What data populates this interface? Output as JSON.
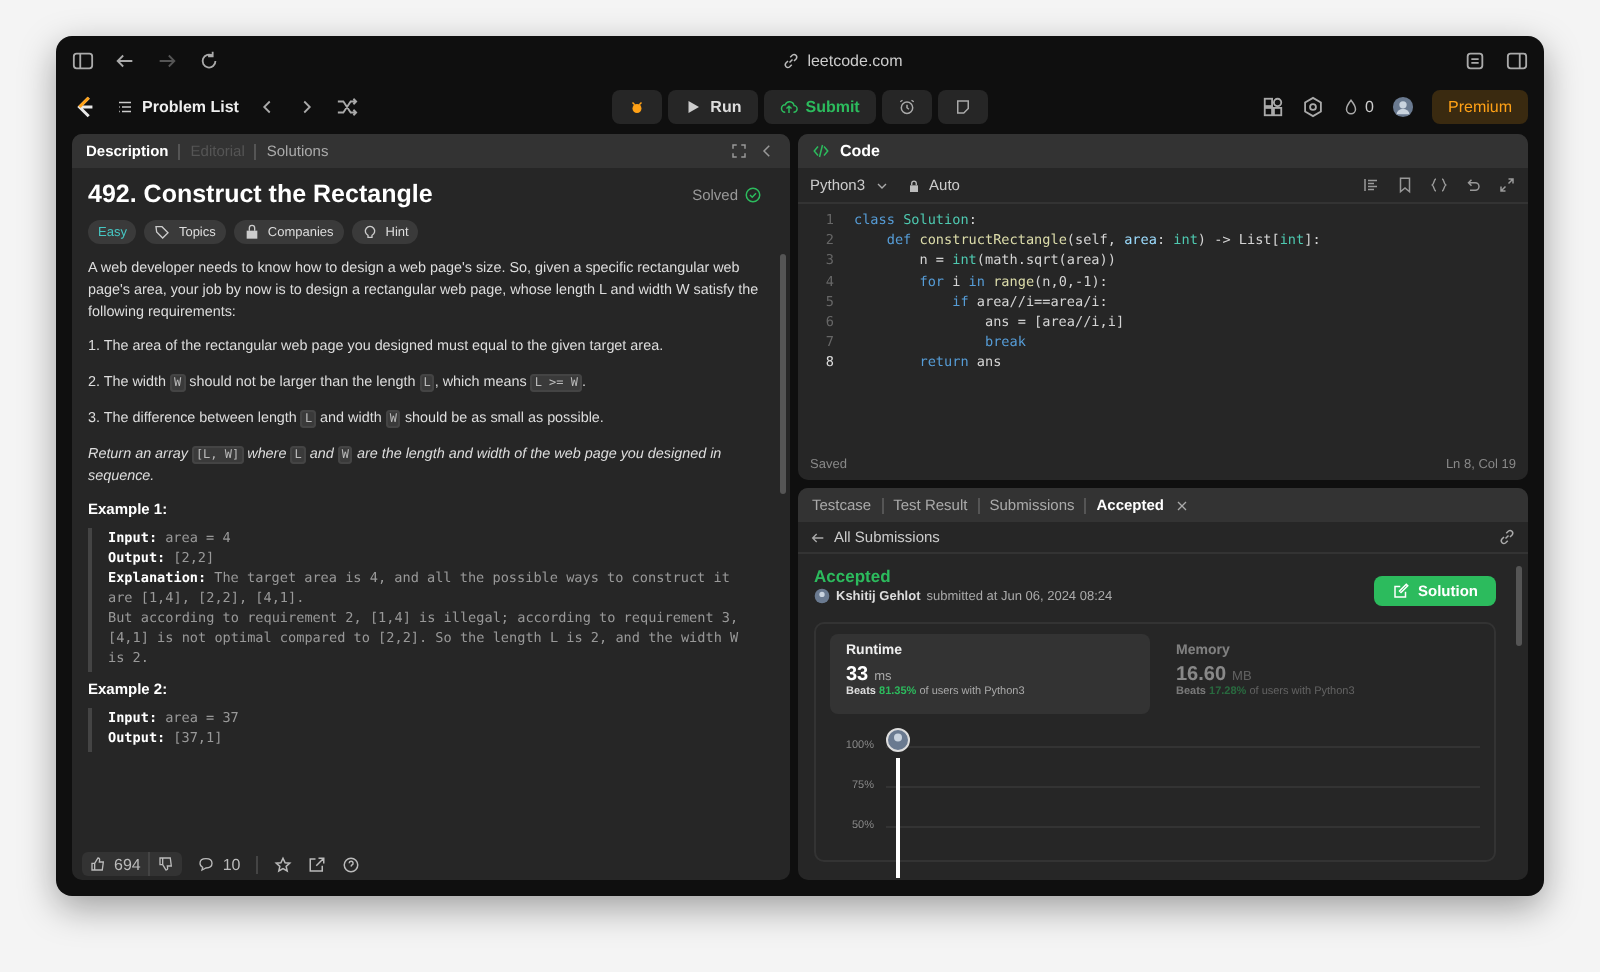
{
  "browser": {
    "url": "leetcode.com"
  },
  "nav": {
    "problem_list": "Problem List",
    "run": "Run",
    "submit": "Submit",
    "coins": "0",
    "premium": "Premium"
  },
  "description": {
    "tabs": [
      {
        "label": "Description",
        "selected": true,
        "disabled": false
      },
      {
        "label": "Editorial",
        "selected": false,
        "disabled": true
      },
      {
        "label": "Solutions",
        "selected": false,
        "disabled": false
      }
    ],
    "title": "492. Construct the Rectangle",
    "status": "Solved",
    "tags": [
      {
        "label": "Easy",
        "kind": "difficulty"
      },
      {
        "label": "Topics",
        "kind": "topics"
      },
      {
        "label": "Companies",
        "kind": "companies"
      },
      {
        "label": "Hint",
        "kind": "hint"
      }
    ],
    "paragraphs": [
      {
        "italic": false,
        "segments": [
          {
            "kind": "text",
            "text": "A web developer needs to know how to design a web page's size. So, given a specific rectangular web page's area, your job by now is to design a rectangular web page, whose length L and width W satisfy the following requirements:"
          }
        ]
      },
      {
        "italic": false,
        "segments": [
          {
            "kind": "text",
            "text": "1. The area of the rectangular web page you designed must equal to the given target area."
          }
        ]
      },
      {
        "italic": false,
        "segments": [
          {
            "kind": "text",
            "text": "2. The width "
          },
          {
            "kind": "code",
            "text": "W"
          },
          {
            "kind": "text",
            "text": " should not be larger than the length "
          },
          {
            "kind": "code",
            "text": "L"
          },
          {
            "kind": "text",
            "text": ", which means "
          },
          {
            "kind": "code",
            "text": "L >= W"
          },
          {
            "kind": "text",
            "text": "."
          }
        ]
      },
      {
        "italic": false,
        "segments": [
          {
            "kind": "text",
            "text": "3. The difference between length "
          },
          {
            "kind": "code",
            "text": "L"
          },
          {
            "kind": "text",
            "text": " and width "
          },
          {
            "kind": "code",
            "text": "W"
          },
          {
            "kind": "text",
            "text": " should be as small as possible."
          }
        ]
      },
      {
        "italic": true,
        "segments": [
          {
            "kind": "text",
            "text": "Return an array "
          },
          {
            "kind": "code",
            "text": "[L, W]"
          },
          {
            "kind": "text",
            "text": " where "
          },
          {
            "kind": "code",
            "text": "L"
          },
          {
            "kind": "text",
            "text": " and "
          },
          {
            "kind": "code",
            "text": "W"
          },
          {
            "kind": "text",
            "text": " are the length and width of the web page you designed in sequence."
          }
        ]
      }
    ],
    "examples": [
      {
        "title": "Example 1:",
        "lines": [
          {
            "label": "Input:",
            "value": "area = 4"
          },
          {
            "label": "Output:",
            "value": "[2,2]"
          },
          {
            "label": "Explanation:",
            "value": "The target area is 4, and all the possible ways to construct it are [1,4], [2,2], [4,1]."
          },
          {
            "value": "But according to requirement 2, [1,4] is illegal; according to requirement 3,  [4,1] is not optimal compared to [2,2]. So the length L is 2, and the width W is 2."
          }
        ]
      },
      {
        "title": "Example 2:",
        "lines": [
          {
            "label": "Input:",
            "value": "area = 37"
          },
          {
            "label": "Output:",
            "value": "[37,1]"
          }
        ]
      }
    ],
    "likes": "694",
    "comments": "10"
  },
  "code": {
    "title": "Code",
    "language": "Python3",
    "mode": "Auto",
    "lines": [
      {
        "no": "1",
        "current": false,
        "tokens": [
          {
            "kind": "kw",
            "text": "class "
          },
          {
            "kind": "type",
            "text": "Solution"
          },
          {
            "kind": "plain",
            "text": ":"
          }
        ]
      },
      {
        "no": "2",
        "current": false,
        "tokens": [
          {
            "kind": "kw",
            "text": "    def "
          },
          {
            "kind": "fn",
            "text": "constructRectangle"
          },
          {
            "kind": "plain",
            "text": "(self, "
          },
          {
            "kind": "param",
            "text": "area"
          },
          {
            "kind": "plain",
            "text": ": "
          },
          {
            "kind": "type",
            "text": "int"
          },
          {
            "kind": "plain",
            "text": ") -> List["
          },
          {
            "kind": "type",
            "text": "int"
          },
          {
            "kind": "plain",
            "text": "]:"
          }
        ]
      },
      {
        "no": "3",
        "current": false,
        "tokens": [
          {
            "kind": "plain",
            "text": "        n = "
          },
          {
            "kind": "type",
            "text": "int"
          },
          {
            "kind": "plain",
            "text": "(math.sqrt(area))"
          }
        ]
      },
      {
        "no": "4",
        "current": false,
        "tokens": [
          {
            "kind": "kw",
            "text": "        for"
          },
          {
            "kind": "plain",
            "text": " i "
          },
          {
            "kind": "kw",
            "text": "in "
          },
          {
            "kind": "fn",
            "text": "range"
          },
          {
            "kind": "plain",
            "text": "(n,0,-1):"
          }
        ]
      },
      {
        "no": "5",
        "current": false,
        "tokens": [
          {
            "kind": "kw",
            "text": "            if"
          },
          {
            "kind": "plain",
            "text": " area//i==area/i:"
          }
        ]
      },
      {
        "no": "6",
        "current": false,
        "tokens": [
          {
            "kind": "plain",
            "text": "                ans = [area//i,i]"
          }
        ]
      },
      {
        "no": "7",
        "current": false,
        "tokens": [
          {
            "kind": "kw",
            "text": "                break"
          }
        ]
      },
      {
        "no": "8",
        "current": true,
        "tokens": [
          {
            "kind": "kw",
            "text": "        return"
          },
          {
            "kind": "plain",
            "text": " ans"
          }
        ]
      }
    ],
    "status": "Saved",
    "cursor": "Ln 8, Col 19"
  },
  "result": {
    "tabs": [
      {
        "label": "Testcase",
        "selected": false,
        "closable": false
      },
      {
        "label": "Test Result",
        "selected": false,
        "closable": false
      },
      {
        "label": "Submissions",
        "selected": false,
        "closable": false
      },
      {
        "label": "Accepted",
        "selected": true,
        "closable": true
      }
    ],
    "back": "All Submissions",
    "verdict": "Accepted",
    "author": "Kshitij Gehlot",
    "submitted": "submitted at Jun 06, 2024 08:24",
    "solution_button": "Solution",
    "cards": [
      {
        "title": "Runtime",
        "selected": true,
        "value": "33",
        "unit": "ms",
        "beats": "Beats",
        "percent": "81.35%",
        "suffix": "of users with Python3"
      },
      {
        "title": "Memory",
        "selected": false,
        "value": "16.60",
        "unit": "MB",
        "beats": "Beats",
        "percent": "17.28%",
        "suffix": "of users with Python3"
      }
    ],
    "axis_labels": [
      "100%",
      "75%",
      "50%"
    ]
  }
}
